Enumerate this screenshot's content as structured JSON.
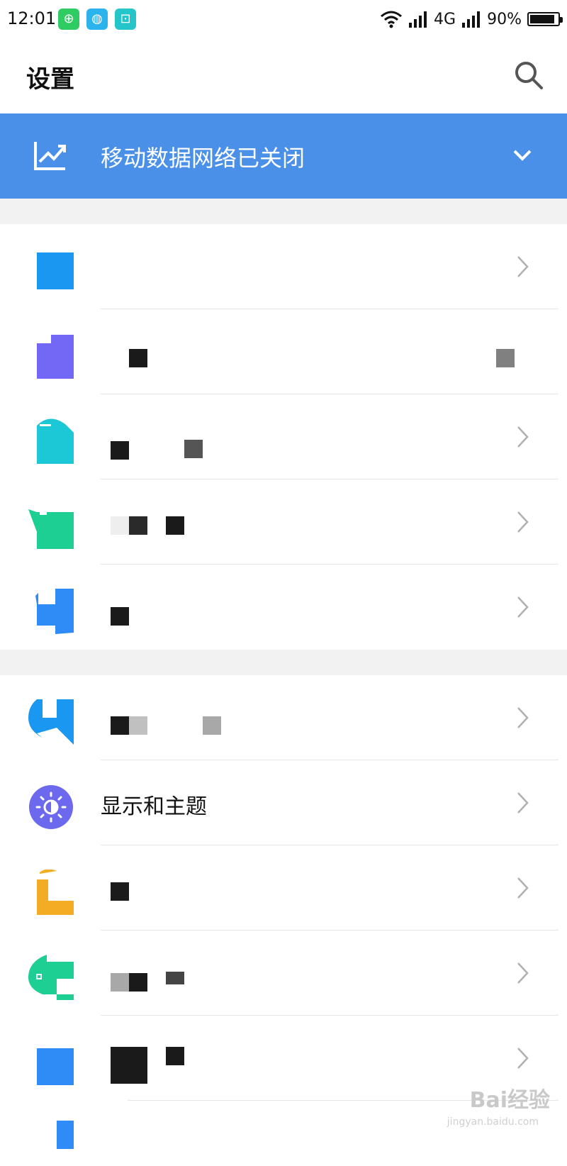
{
  "status_bar": {
    "time": "12:01",
    "network": "4G",
    "battery": "90%",
    "battery_level": 0.9
  },
  "header": {
    "title": "设置"
  },
  "banner": {
    "text": "移动数据网络已关闭"
  },
  "rows": [
    {
      "label": "",
      "icon": "square-icon",
      "color": "#1a97f0"
    },
    {
      "label": "",
      "icon": "purple-app-icon",
      "color": "#7368f5"
    },
    {
      "label": "",
      "icon": "teal-app-icon",
      "color": "#1cc8d6"
    },
    {
      "label": "",
      "icon": "green-app-icon",
      "color": "#1dcf93"
    },
    {
      "label": "",
      "icon": "blue-app-icon",
      "color": "#2f8cf6"
    },
    {
      "label": "",
      "icon": "blue-app-icon-2",
      "color": "#1a97f0"
    },
    {
      "label": "显示和主题",
      "icon": "display-theme-icon",
      "color": "#6c69ef"
    },
    {
      "label": "",
      "icon": "yellow-app-icon",
      "color": "#f3ac24"
    },
    {
      "label": "",
      "icon": "green-app-icon-2",
      "color": "#1dcf93"
    },
    {
      "label": "",
      "icon": "blue-square-icon",
      "color": "#2f8cf6"
    },
    {
      "label": "",
      "icon": "blue-app-icon-3",
      "color": "#2f8cf6"
    }
  ],
  "watermark": {
    "brand": "Bai经验",
    "site": "jingyan.baidu.com"
  }
}
